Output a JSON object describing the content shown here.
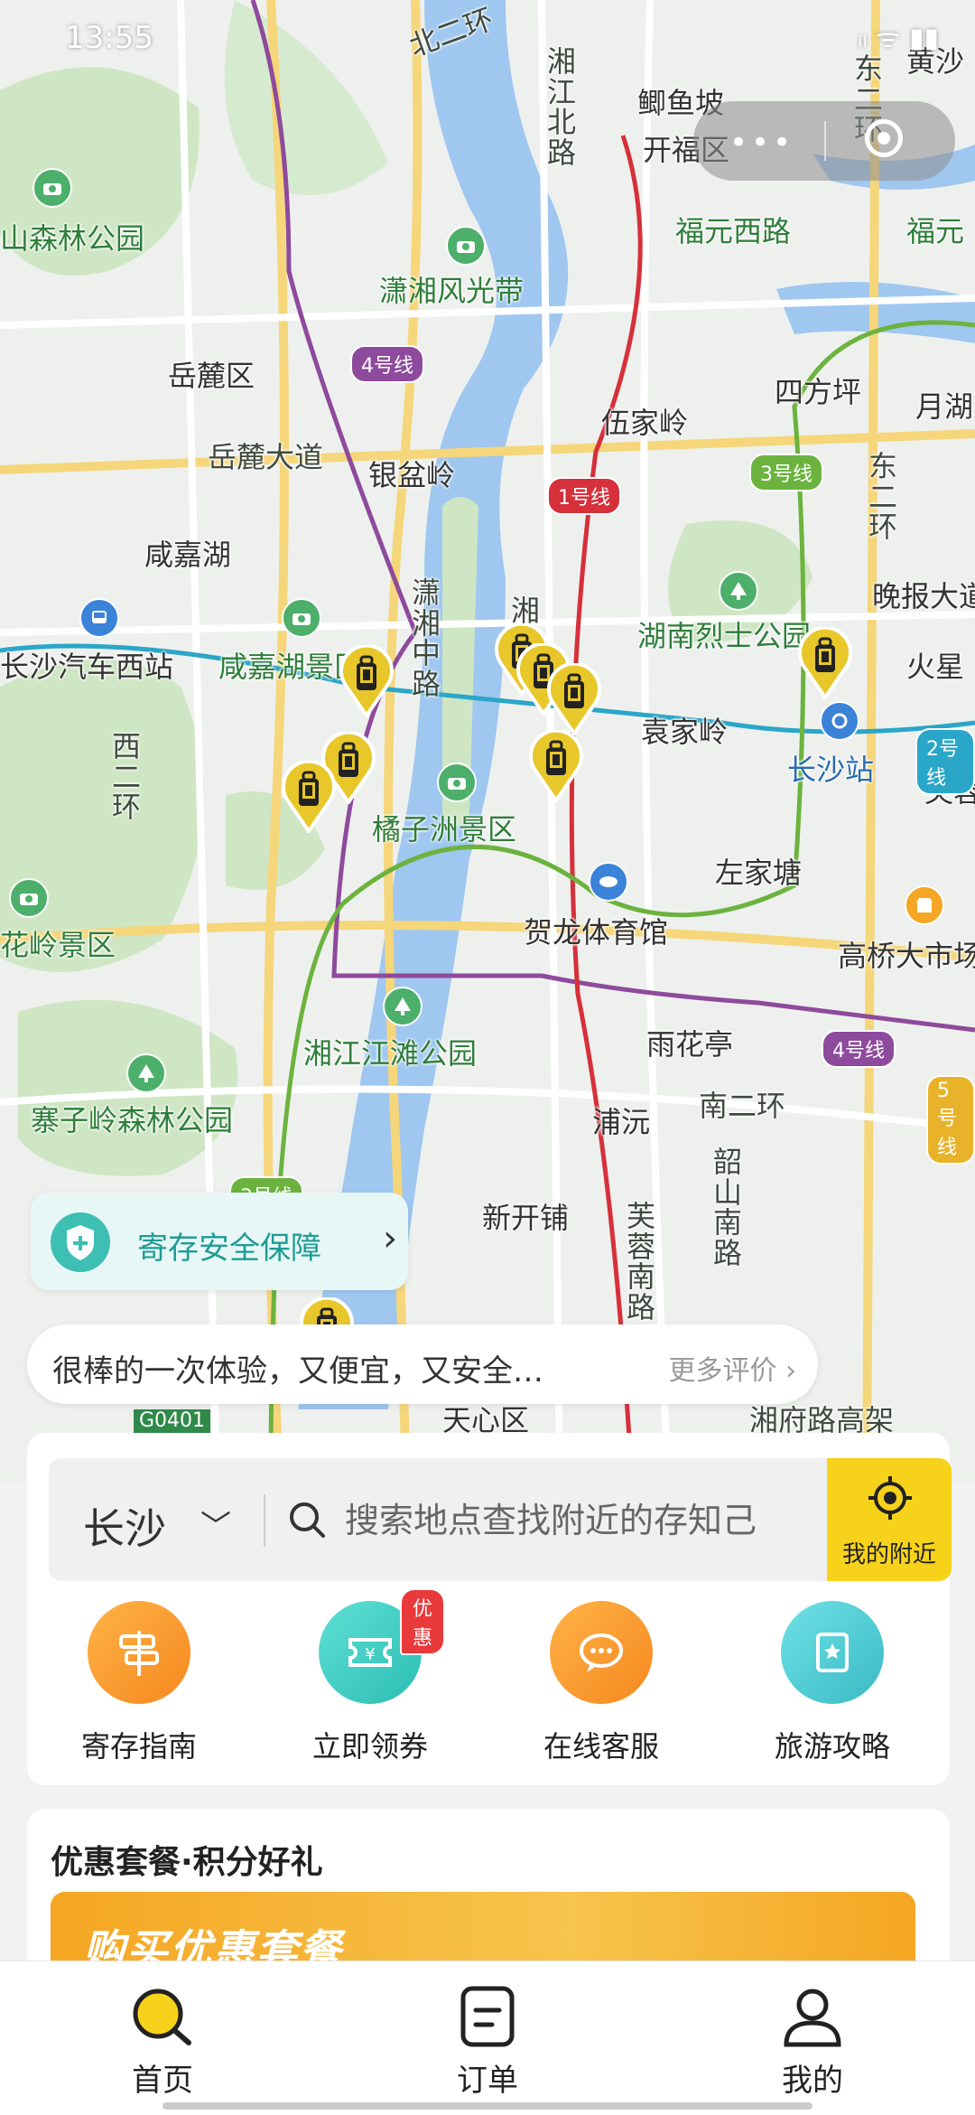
{
  "status_bar": {
    "time": "13:55",
    "icons": "ᵢₗ ᯤ ▮▮"
  },
  "capsule": {
    "more": "•••"
  },
  "map": {
    "places": [
      {
        "id": "juyu",
        "text": "鲫鱼坡"
      },
      {
        "id": "kaifu",
        "text": "开福区"
      },
      {
        "id": "huangsha",
        "text": "黄沙"
      },
      {
        "id": "fuyuan-w",
        "text": "福元西路"
      },
      {
        "id": "fuyuan-e",
        "text": "福元"
      },
      {
        "id": "shanlin",
        "text": "山森林公园"
      },
      {
        "id": "xiaoxiang",
        "text": "潇湘风光带"
      },
      {
        "id": "yuelu",
        "text": "岳麓区"
      },
      {
        "id": "yuelu-ave",
        "text": "岳麓大道"
      },
      {
        "id": "yinpen",
        "text": "银盆岭"
      },
      {
        "id": "wujia",
        "text": "伍家岭"
      },
      {
        "id": "sifangping",
        "text": "四方坪"
      },
      {
        "id": "yuehu",
        "text": "月湖"
      },
      {
        "id": "xianjiahu",
        "text": "咸嘉湖"
      },
      {
        "id": "wanbao",
        "text": "晚报大道"
      },
      {
        "id": "lieshi",
        "text": "湖南烈士公园"
      },
      {
        "id": "huoxing",
        "text": "火星"
      },
      {
        "id": "westbus",
        "text": "长沙汽车西站"
      },
      {
        "id": "xianjiahu-scenic",
        "text": "咸嘉湖景区"
      },
      {
        "id": "yuanjialing",
        "text": "袁家岭"
      },
      {
        "id": "changsha-stn",
        "text": "长沙站"
      },
      {
        "id": "furong",
        "text": "芙蓉"
      },
      {
        "id": "juzizhou",
        "text": "橘子洲景区"
      },
      {
        "id": "zuojiatang",
        "text": "左家塘"
      },
      {
        "id": "helong",
        "text": "贺龙体育馆"
      },
      {
        "id": "gaoqiao",
        "text": "高桥大市场"
      },
      {
        "id": "xiangjiang-park",
        "text": "湘江江滩公园"
      },
      {
        "id": "yuhuating",
        "text": "雨花亭"
      },
      {
        "id": "zhaizi",
        "text": "寨子岭森林公园"
      },
      {
        "id": "puyuan",
        "text": "浦沅"
      },
      {
        "id": "nan2",
        "text": "南二环"
      },
      {
        "id": "xinkaipu",
        "text": "新开铺"
      },
      {
        "id": "tianxin",
        "text": "天心区"
      },
      {
        "id": "xiangfu",
        "text": "湘府路高架"
      },
      {
        "id": "g0401",
        "text": "G0401"
      },
      {
        "id": "qiuling",
        "text": "花岭景区"
      }
    ],
    "vertical_roads": [
      {
        "id": "beiyi",
        "text": "北二环"
      },
      {
        "id": "xiangjiang-n",
        "text": "湘江北路"
      },
      {
        "id": "dong2",
        "text": "东二环"
      },
      {
        "id": "xiangjiang-m",
        "text": "潇湘中路"
      },
      {
        "id": "xiang-road",
        "text": "湘江路"
      },
      {
        "id": "furong-s",
        "text": "芙蓉南路"
      },
      {
        "id": "shaoshan",
        "text": "韶山南路"
      },
      {
        "id": "xi2",
        "text": "西二环"
      },
      {
        "id": "dong-huan",
        "text": "东二环"
      }
    ],
    "line_badges": [
      {
        "id": "l4a",
        "text": "4号线",
        "color": "#8e4a9c"
      },
      {
        "id": "l1",
        "text": "1号线",
        "color": "#d6303b"
      },
      {
        "id": "l3",
        "text": "3号线",
        "color": "#6bb33e"
      },
      {
        "id": "l2",
        "text": "2号线",
        "color": "#2aa6c8"
      },
      {
        "id": "l4b",
        "text": "4号线",
        "color": "#8e4a9c"
      },
      {
        "id": "l5",
        "text": "5号线",
        "color": "#e8b32a"
      },
      {
        "id": "l3b",
        "text": "3号线",
        "color": "#6bb33e"
      }
    ]
  },
  "security_banner": {
    "text": "寄存安全保障",
    "arrow": "›"
  },
  "review": {
    "text": "很棒的一次体验，又便宜，又安全…",
    "more": "更多评价 ›"
  },
  "search": {
    "city": "长沙",
    "city_chevron": "﹀",
    "placeholder": "搜索地点查找附近的存知己",
    "nearby_label": "我的附近"
  },
  "features": [
    {
      "id": "guide",
      "label": "寄存指南",
      "color": "#f59a24"
    },
    {
      "id": "coupon",
      "label": "立即领券",
      "color": "#36c9c0",
      "badge": "优惠"
    },
    {
      "id": "service",
      "label": "在线客服",
      "color": "#f59a24"
    },
    {
      "id": "travel",
      "label": "旅游攻略",
      "color": "#44c4c8"
    }
  ],
  "promo": {
    "title": "优惠套餐·积分好礼",
    "banner_text": "购买优惠套餐"
  },
  "tabs": [
    {
      "id": "home",
      "label": "首页",
      "active": true
    },
    {
      "id": "orders",
      "label": "订单",
      "active": false
    },
    {
      "id": "mine",
      "label": "我的",
      "active": false
    }
  ],
  "colors": {
    "accent": "#f7d21a",
    "teal": "#1f9c95"
  }
}
